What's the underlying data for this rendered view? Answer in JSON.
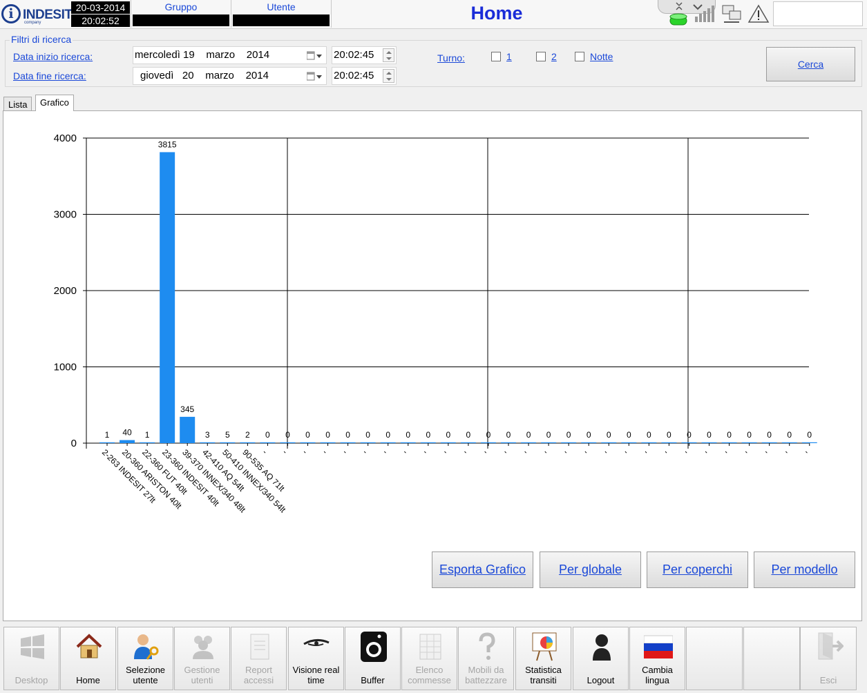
{
  "header": {
    "logo": "INDESIT",
    "logo_sub": "company",
    "date": "20-03-2014",
    "time": "20:02:52",
    "gruppo_label": "Gruppo",
    "utente_label": "Utente",
    "title": "Home"
  },
  "filters": {
    "legend": "Filtri di ricerca",
    "start_label": "Data inizio ricerca:",
    "end_label": "Data fine ricerca:",
    "start_date": "mercoledì 19    marzo    2014",
    "end_date": "giovedì   20    marzo    2014",
    "start_time": "20:02:45",
    "end_time": "20:02:45",
    "turno_label": "Turno:",
    "turni": [
      "1",
      "2",
      "Notte"
    ],
    "search_button": "Cerca"
  },
  "tabs": [
    "Lista",
    "Grafico"
  ],
  "active_tab": "Grafico",
  "chart_data": {
    "type": "bar",
    "ylim": [
      0,
      4000
    ],
    "yticks": [
      0,
      1000,
      2000,
      3000,
      4000
    ],
    "grid": true,
    "bar_color": "#1e8cf0",
    "categories": [
      "2-263 INDESIT 27lt",
      "20-360 ARISTON 40lt",
      "22-360 FUT 40lt",
      "23-360 INDESIT 40lt",
      "39-370 INNEX/340 48lt",
      "42-410 AQ 54lt",
      "50-410 INNEX/340 54lt",
      "90-535 AQ 71lt",
      "-",
      "-",
      "-",
      "-",
      "-",
      "-",
      "-",
      "-",
      "-",
      "-",
      "-",
      "-",
      "-",
      "-",
      "-",
      "-",
      "-",
      "-",
      "-",
      "-",
      "-",
      "-",
      "-",
      "-",
      "-",
      "-",
      "-",
      "-"
    ],
    "values": [
      1,
      40,
      1,
      3815,
      345,
      3,
      5,
      2,
      0,
      0,
      0,
      0,
      0,
      0,
      0,
      0,
      0,
      0,
      0,
      0,
      0,
      0,
      0,
      0,
      0,
      0,
      0,
      0,
      0,
      0,
      0,
      0,
      0,
      0,
      0,
      0
    ]
  },
  "panel_buttons": [
    "Esporta Grafico",
    "Per globale",
    "Per coperchi",
    "Per modello"
  ],
  "taskbar": [
    {
      "label": "Desktop",
      "icon": "windows-icon",
      "enabled": false
    },
    {
      "label": "Home",
      "icon": "house-icon",
      "enabled": true
    },
    {
      "label": "Selezione utente",
      "icon": "user-key-icon",
      "enabled": true
    },
    {
      "label": "Gestione utenti",
      "icon": "users-icon",
      "enabled": false
    },
    {
      "label": "Report accessi",
      "icon": "report-icon",
      "enabled": false
    },
    {
      "label": "Visione real time",
      "icon": "eye-icon",
      "enabled": true
    },
    {
      "label": "Buffer",
      "icon": "washing-machine-icon",
      "enabled": true
    },
    {
      "label": "Elenco commesse",
      "icon": "spreadsheet-icon",
      "enabled": false
    },
    {
      "label": "Mobili da battezzare",
      "icon": "question-icon",
      "enabled": false
    },
    {
      "label": "Statistica transiti",
      "icon": "pie-chart-icon",
      "enabled": true
    },
    {
      "label": "Logout",
      "icon": "person-silhouette-icon",
      "enabled": true
    },
    {
      "label": "Cambia lingua",
      "icon": "russian-flag-icon",
      "enabled": true
    },
    {
      "label": "",
      "icon": "",
      "enabled": false
    },
    {
      "label": "",
      "icon": "",
      "enabled": false
    },
    {
      "label": "Esci",
      "icon": "exit-door-icon",
      "enabled": false
    }
  ]
}
